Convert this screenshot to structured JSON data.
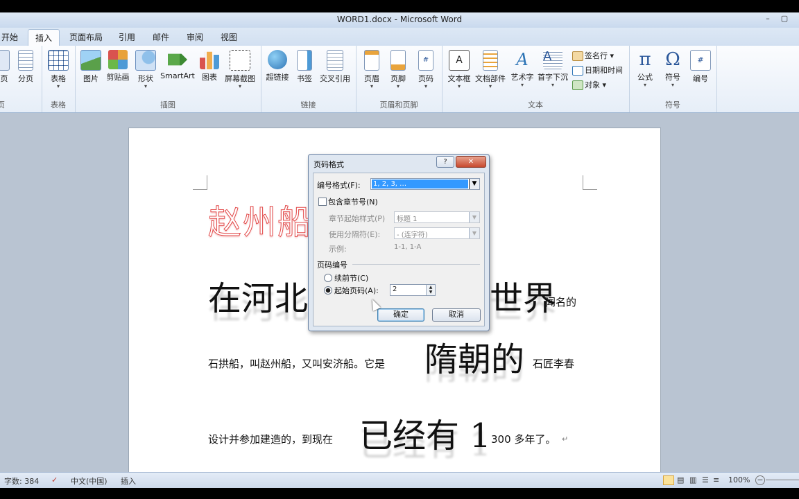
{
  "window": {
    "title": "WORD1.docx - Microsoft Word"
  },
  "tabs": [
    "开始",
    "插入",
    "页面布局",
    "引用",
    "邮件",
    "审阅",
    "视图"
  ],
  "active_tab": "插入",
  "ribbon": {
    "left_partial": {
      "b1": "页",
      "b2": "分页",
      "label": "页"
    },
    "table": {
      "table_btn": "表格",
      "label": "表格"
    },
    "illustrations": {
      "picture": "图片",
      "clipart": "剪贴画",
      "shapes": "形状",
      "smartart": "SmartArt",
      "chart": "图表",
      "screenshot": "屏幕截图",
      "label": "插图"
    },
    "links": {
      "hyperlink": "超链接",
      "bookmark": "书签",
      "crossref": "交叉引用",
      "label": "链接"
    },
    "header_footer": {
      "header": "页眉",
      "footer": "页脚",
      "page_number": "页码",
      "label": "页眉和页脚"
    },
    "text": {
      "textbox": "文本框",
      "quickparts": "文档部件",
      "wordart": "艺术字",
      "dropcap": "首字下沉",
      "signature": "签名行",
      "datetime": "日期和时间",
      "object": "对象",
      "label": "文本"
    },
    "symbols": {
      "equation": "公式",
      "symbol": "符号",
      "number": "编号",
      "label": "符号"
    }
  },
  "document": {
    "title_line": "赵州船",
    "line1_big_left": "在河北",
    "line1_big_right": "世界",
    "line1_small": "闻名的",
    "line2_small_left": "石拱船，叫赵州船，又叫安济船。它是",
    "line2_big": "隋朝的",
    "line2_small_right": "石匠李春",
    "line3_small_left": "设计并参加建造的，到现在",
    "line3_big": "已经有 1",
    "line3_small_right": "300 多年了。",
    "para_mark": "↵"
  },
  "dialog": {
    "title": "页码格式",
    "help": "?",
    "close": "✕",
    "format_label": "编号格式(F):",
    "format_value": "1, 2, 3, …",
    "include_chapter_label": "包含章节号(N)",
    "chapter_style_label": "章节起始样式(P)",
    "chapter_style_value": "标题 1",
    "separator_label": "使用分隔符(E):",
    "separator_value": "-  (连字符)",
    "example_label": "示例:",
    "example_value": "1-1, 1-A",
    "numbering_section": "页码编号",
    "continue_label": "续前节(C)",
    "start_at_label": "起始页码(A):",
    "start_at_value": "2",
    "ok": "确定",
    "cancel": "取消"
  },
  "status": {
    "word_count": "字数: 384",
    "language": "中文(中国)",
    "mode": "插入",
    "zoom": "100%"
  },
  "colors": {
    "accent": "#2b579a",
    "title_red": "#e24a4a"
  }
}
